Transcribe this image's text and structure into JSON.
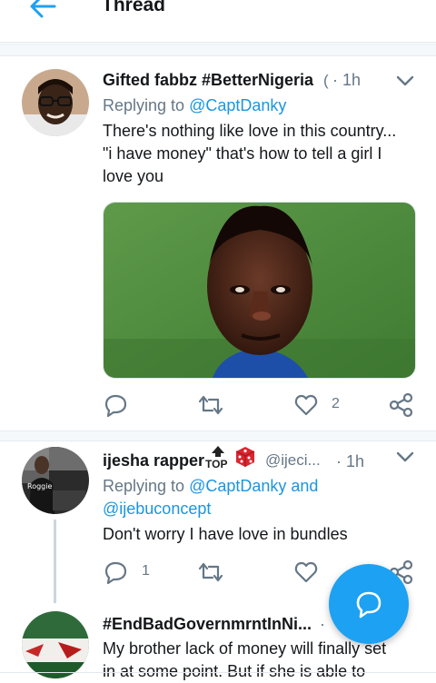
{
  "header": {
    "title": "Thread"
  },
  "tweets": [
    {
      "name": "Gifted fabbz #BetterNigeria",
      "handle": "(",
      "time": "· 1h",
      "replying_prefix": "Replying to ",
      "replying_to": "@CaptDanky",
      "line1": "There's nothing like love in this country...",
      "line2": "\"i have money\" that's how to tell a girl I",
      "line3": "love you",
      "likes": "2"
    },
    {
      "name": "ijesha rapper",
      "handle": "@ijeci...",
      "time": "· 1h",
      "replying_prefix": "Replying to ",
      "replying_to_1": "@CaptDanky",
      "replying_and": " and",
      "replying_to_2": "@ijebuconcept",
      "text": "Don't worry I have love in bundles",
      "replies": "1",
      "top_badge": "TOP"
    },
    {
      "name": "#EndBadGovernmrntInNi...",
      "time": "·",
      "line1": "My brother lack of money will finally set",
      "line2": "in at some point. But if she is able to"
    }
  ],
  "colors": {
    "accent": "#1da1f2",
    "link": "#1b95e0",
    "muted": "#657786"
  },
  "icons": [
    "back-arrow-icon",
    "chevron-down-icon",
    "reply-icon",
    "retweet-icon",
    "like-icon",
    "share-icon",
    "top-badge-icon",
    "dice-icon",
    "compose-reply-icon"
  ]
}
